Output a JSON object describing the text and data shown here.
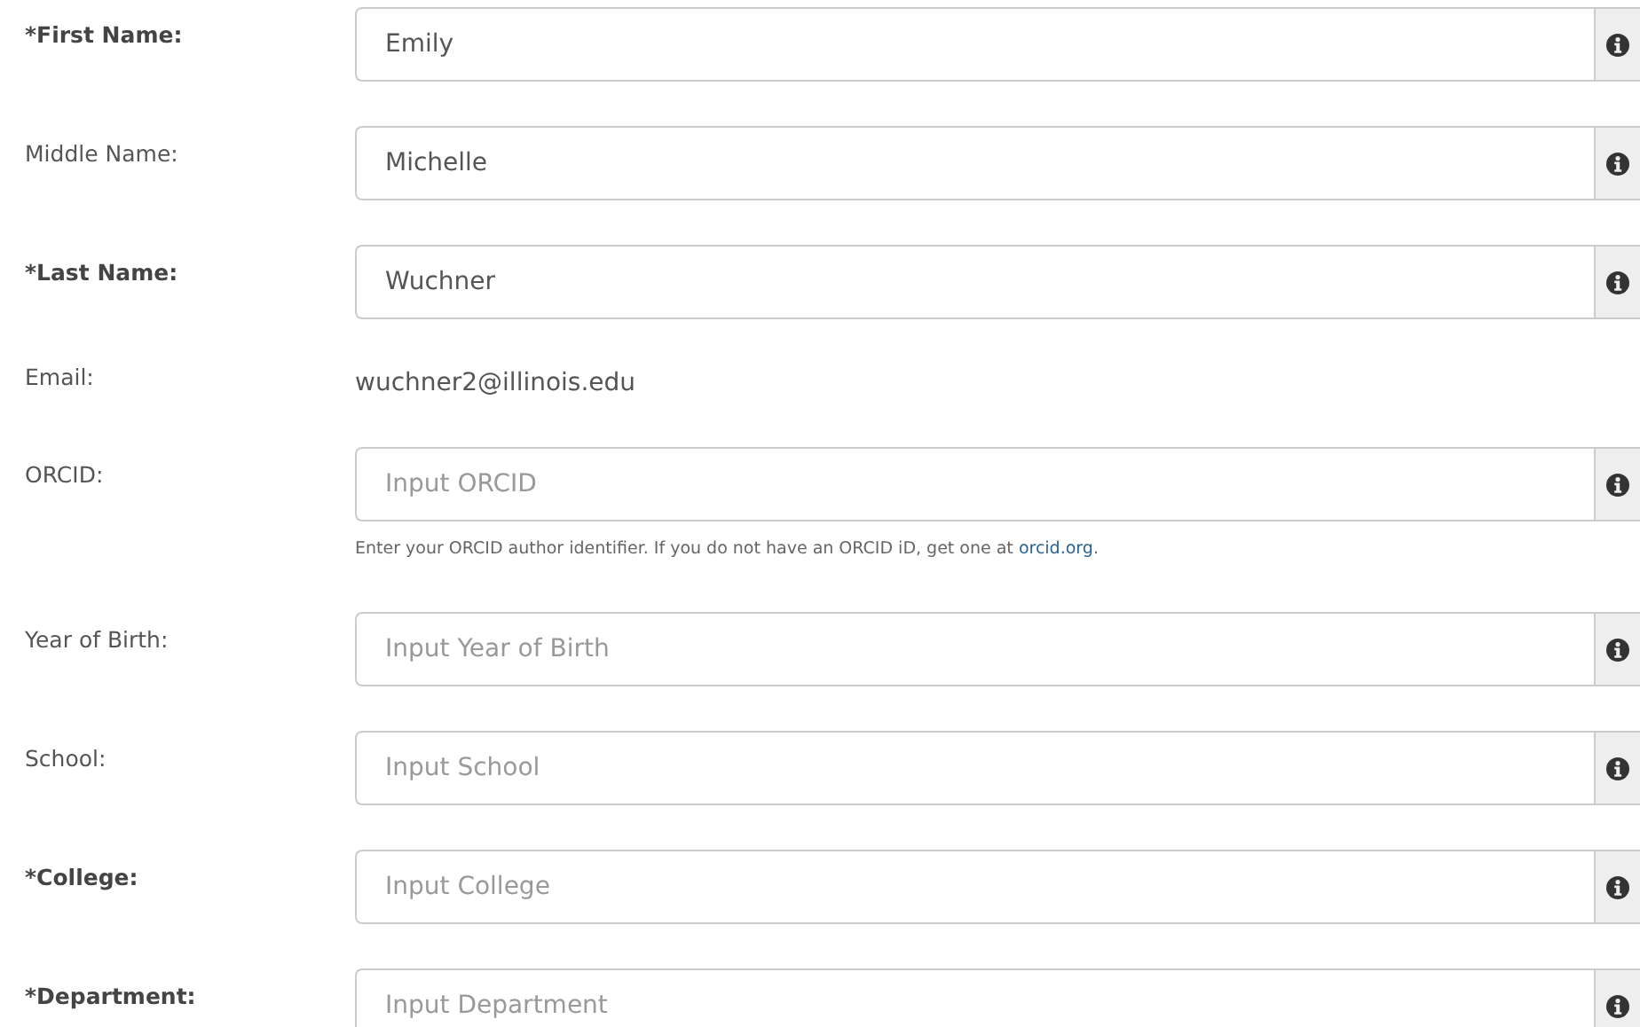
{
  "fields": [
    {
      "kind": "input",
      "label": "*First Name:",
      "required": true,
      "value": "Emily"
    },
    {
      "kind": "input",
      "label": "Middle Name:",
      "required": false,
      "value": "Michelle"
    },
    {
      "kind": "input",
      "label": "*Last Name:",
      "required": true,
      "value": "Wuchner"
    },
    {
      "kind": "text",
      "label": "Email:",
      "required": false,
      "value": "wuchner2@illinois.edu"
    },
    {
      "kind": "input",
      "label": "ORCID:",
      "required": false,
      "placeholder": "Input ORCID",
      "help": {
        "text": "Enter your ORCID author identifier. If you do not have an ORCID iD, get one at ",
        "link": "orcid.org",
        "after": "."
      }
    },
    {
      "kind": "input",
      "label": "Year of Birth:",
      "required": false,
      "placeholder": "Input Year of Birth"
    },
    {
      "kind": "input",
      "label": "School:",
      "required": false,
      "placeholder": "Input School"
    },
    {
      "kind": "input",
      "label": "*College:",
      "required": true,
      "placeholder": "Input College"
    },
    {
      "kind": "input",
      "label": "*Department:",
      "required": true,
      "placeholder": "Input Department"
    }
  ]
}
